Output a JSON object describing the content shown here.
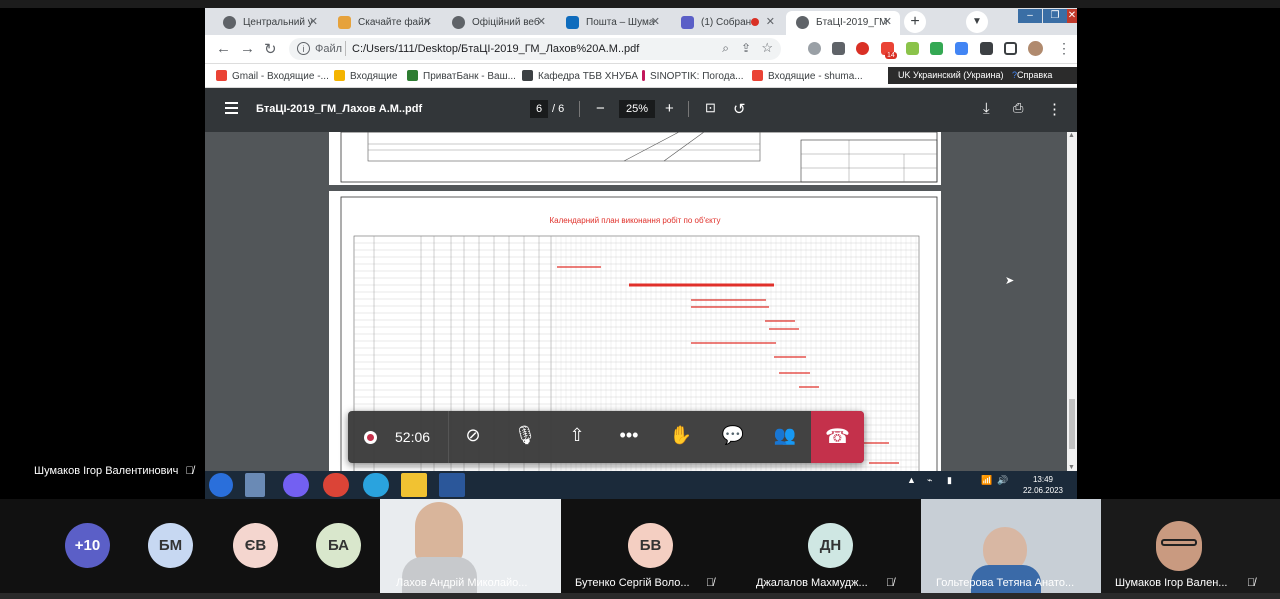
{
  "browser": {
    "tabs": [
      {
        "title": "Центральний у",
        "active": false
      },
      {
        "title": "Скачайте файл",
        "active": false
      },
      {
        "title": "Офіційний веб",
        "active": false
      },
      {
        "title": "Пошта – Шума",
        "active": false
      },
      {
        "title": "(1) Собран",
        "active": false
      },
      {
        "title": "БтаЦІ-2019_ГМ",
        "active": true
      }
    ],
    "new_tab": "+",
    "address": {
      "scheme": "Файл",
      "url": "C:/Users/111/Desktop/БтаЦІ-2019_ГМ_Лахов%20А.М..pdf"
    },
    "ext_badge": "14",
    "bookmarks": [
      "Gmail - Входящие -...",
      "Входящие",
      "ПриватБанк - Ваш...",
      "Кафедра ТБВ ХНУБА",
      "SINOPTIK: Погода...",
      "Входящие - shuma..."
    ],
    "language_bar": {
      "lang": "UK Украинский (Украина)",
      "help": "Справка"
    }
  },
  "pdf": {
    "title": "БтаЦІ-2019_ГМ_Лахов А.М..pdf",
    "page_current": "6",
    "page_total": "/ 6",
    "zoom": "25%",
    "plan_title": "Календарний план виконання робіт по об'єкту"
  },
  "meeting": {
    "timer": "52:06",
    "presenter": "Шумаков Ігор Валентинович",
    "participants": [
      {
        "type": "counter",
        "label": "+10",
        "color": "#5b5fc7"
      },
      {
        "type": "avatar",
        "label": "БМ",
        "color": "#c7d8f2"
      },
      {
        "type": "avatar",
        "label": "ЄВ",
        "color": "#f4d6cf"
      },
      {
        "type": "avatar",
        "label": "БА",
        "color": "#d9e7cc"
      },
      {
        "type": "video",
        "name": "Лахов Андрій Миколайо..."
      },
      {
        "type": "avatar",
        "label": "БВ",
        "color": "#f4cfc2",
        "name": "Бутенко Сергій Воло..."
      },
      {
        "type": "avatar",
        "label": "ДН",
        "color": "#cfe7e3",
        "name": "Джалалов Махмудж..."
      },
      {
        "type": "video",
        "name": "Гольтерова Тетяна Анато..."
      },
      {
        "type": "video",
        "name": "Шумаков Ігор Вален..."
      }
    ]
  },
  "taskbar": {
    "time": "13:49",
    "date": "22.06.2023"
  }
}
